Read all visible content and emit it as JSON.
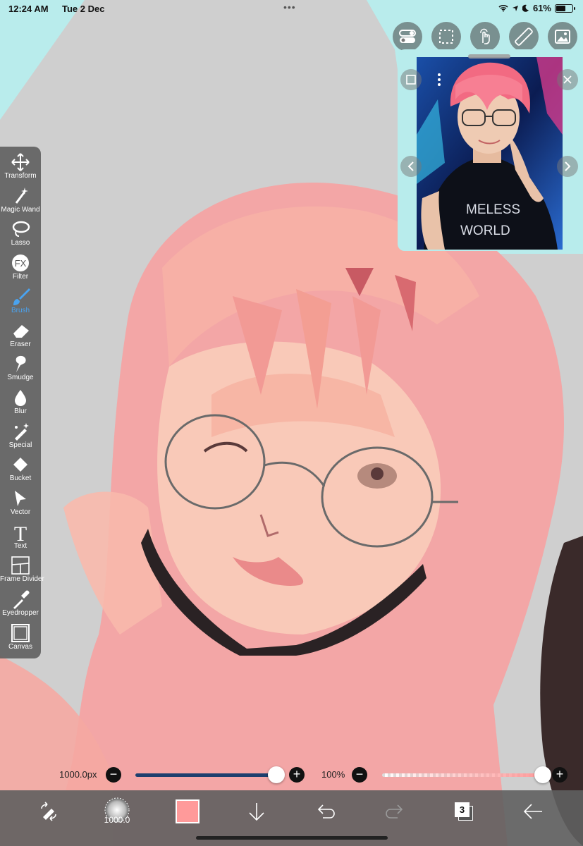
{
  "status_bar": {
    "time": "12:24 AM",
    "date": "Tue 2 Dec",
    "battery": "61%",
    "battery_level": 0.61
  },
  "top_tools": [
    {
      "name": "toggle-icon"
    },
    {
      "name": "selection-icon"
    },
    {
      "name": "touch-icon"
    },
    {
      "name": "ruler-icon"
    },
    {
      "name": "image-icon"
    }
  ],
  "toolbar": {
    "active": "Brush",
    "items": [
      {
        "label": "Transform",
        "icon": "transform-icon"
      },
      {
        "label": "Magic Wand",
        "icon": "magic-wand-icon"
      },
      {
        "label": "Lasso",
        "icon": "lasso-icon"
      },
      {
        "label": "Filter",
        "icon": "filter-icon"
      },
      {
        "label": "Brush",
        "icon": "brush-icon"
      },
      {
        "label": "Eraser",
        "icon": "eraser-icon"
      },
      {
        "label": "Smudge",
        "icon": "smudge-icon"
      },
      {
        "label": "Blur",
        "icon": "blur-icon"
      },
      {
        "label": "Special",
        "icon": "special-icon"
      },
      {
        "label": "Bucket",
        "icon": "bucket-icon"
      },
      {
        "label": "Vector",
        "icon": "vector-icon"
      },
      {
        "label": "Text",
        "icon": "text-icon"
      },
      {
        "label": "Frame Divider",
        "icon": "frame-divider-icon"
      },
      {
        "label": "Eyedropper",
        "icon": "eyedropper-icon"
      },
      {
        "label": "Canvas",
        "icon": "canvas-icon"
      }
    ]
  },
  "reference_window": {
    "shirt_text_1": "MELESS",
    "shirt_text_2": "WORLD"
  },
  "brush_size": {
    "label": "1000.0px",
    "level": 0.98
  },
  "opacity": {
    "label": "100%",
    "level": 1.0
  },
  "bottom_bar": {
    "brush_preview_label": "1000.0",
    "layer_count": "3",
    "color": "#ff9a9a"
  },
  "colors": {
    "canvas_bg": "#cfcfcf",
    "toolbar_bg": "#5a5a5a",
    "accent": "#4aa3f0",
    "slider_fill": "#1d3f6e",
    "reference_bg": "#b8ecec"
  }
}
